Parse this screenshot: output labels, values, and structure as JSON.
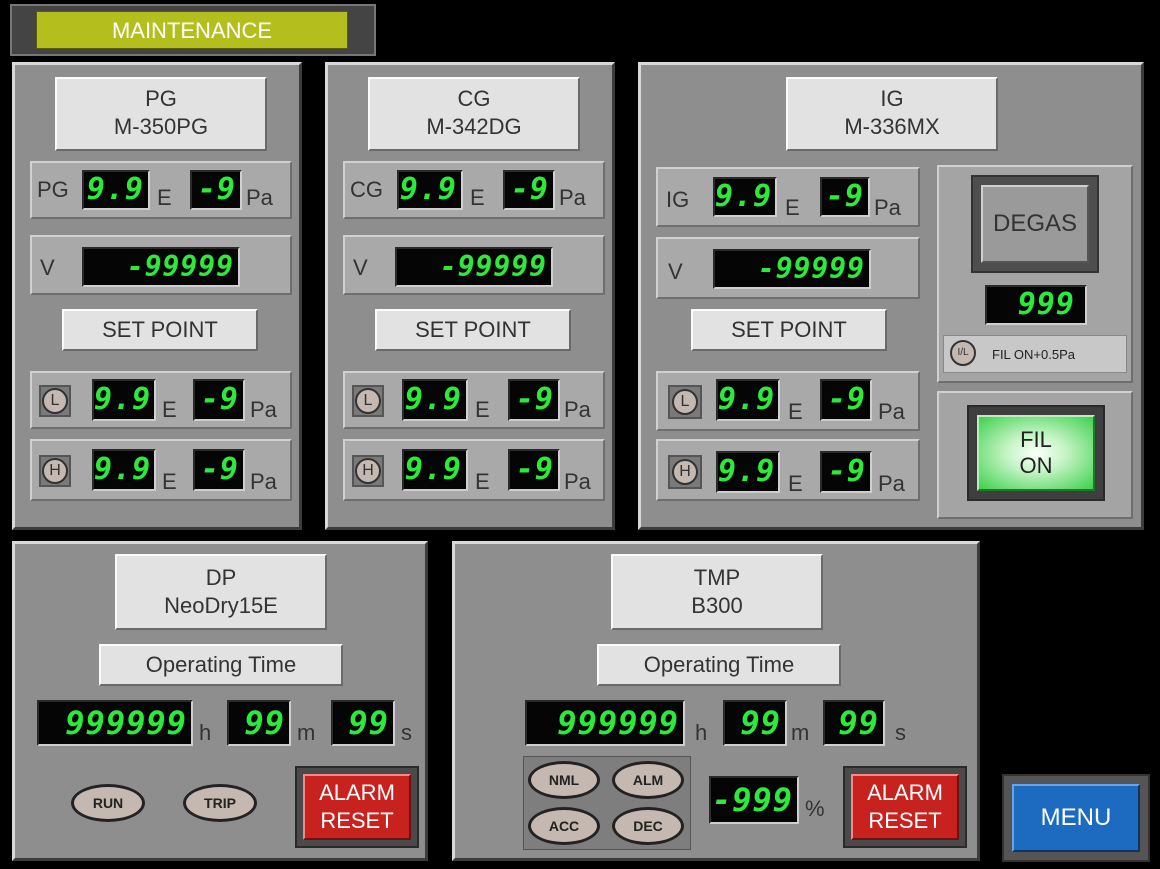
{
  "header": {
    "title": "MAINTENANCE"
  },
  "pg": {
    "title": "PG",
    "model": "M-350PG",
    "gauge_label": "PG",
    "mantissa": "9.9",
    "exp_sep": "E",
    "exponent": "-9",
    "unit": "Pa",
    "v_label": "V",
    "v_value": "-99999",
    "setpoint_label": "SET POINT",
    "low": {
      "badge": "L",
      "mantissa": "9.9",
      "exp_sep": "E",
      "exponent": "-9",
      "unit": "Pa"
    },
    "high": {
      "badge": "H",
      "mantissa": "9.9",
      "exp_sep": "E",
      "exponent": "-9",
      "unit": "Pa"
    }
  },
  "cg": {
    "title": "CG",
    "model": "M-342DG",
    "gauge_label": "CG",
    "mantissa": "9.9",
    "exp_sep": "E",
    "exponent": "-9",
    "unit": "Pa",
    "v_label": "V",
    "v_value": "-99999",
    "setpoint_label": "SET POINT",
    "low": {
      "badge": "L",
      "mantissa": "9.9",
      "exp_sep": "E",
      "exponent": "-9",
      "unit": "Pa"
    },
    "high": {
      "badge": "H",
      "mantissa": "9.9",
      "exp_sep": "E",
      "exponent": "-9",
      "unit": "Pa"
    }
  },
  "ig": {
    "title": "IG",
    "model": "M-336MX",
    "gauge_label": "IG",
    "mantissa": "9.9",
    "exp_sep": "E",
    "exponent": "-9",
    "unit": "Pa",
    "v_label": "V",
    "v_value": "-99999",
    "setpoint_label": "SET POINT",
    "low": {
      "badge": "L",
      "mantissa": "9.9",
      "exp_sep": "E",
      "exponent": "-9",
      "unit": "Pa"
    },
    "high": {
      "badge": "H",
      "mantissa": "9.9",
      "exp_sep": "E",
      "exponent": "-9",
      "unit": "Pa"
    },
    "degas_label": "DEGAS",
    "degas_value": "999",
    "interlock_badge": "I/L",
    "interlock_text": "FIL ON+0.5Pa",
    "fil_line1": "FIL",
    "fil_line2": "ON"
  },
  "dp": {
    "title": "DP",
    "model": "NeoDry15E",
    "op_time_label": "Operating Time",
    "hours": "999999",
    "h_unit": "h",
    "minutes": "99",
    "m_unit": "m",
    "seconds": "99",
    "s_unit": "s",
    "run_label": "RUN",
    "trip_label": "TRIP",
    "alarm_line1": "ALARM",
    "alarm_line2": "RESET"
  },
  "tmp": {
    "title": "TMP",
    "model": "B300",
    "op_time_label": "Operating Time",
    "hours": "999999",
    "h_unit": "h",
    "minutes": "99",
    "m_unit": "m",
    "seconds": "99",
    "s_unit": "s",
    "nml_label": "NML",
    "alm_label": "ALM",
    "acc_label": "ACC",
    "dec_label": "DEC",
    "percent_value": "-999",
    "percent_unit": "%",
    "alarm_line1": "ALARM",
    "alarm_line2": "RESET"
  },
  "menu": {
    "label": "MENU"
  },
  "colors": {
    "segment": "#2bea3a",
    "alarm": "#c8221f",
    "menu": "#1c6bc0",
    "fil_on": "#3ed04e",
    "header_bg": "#b4bf1e"
  }
}
